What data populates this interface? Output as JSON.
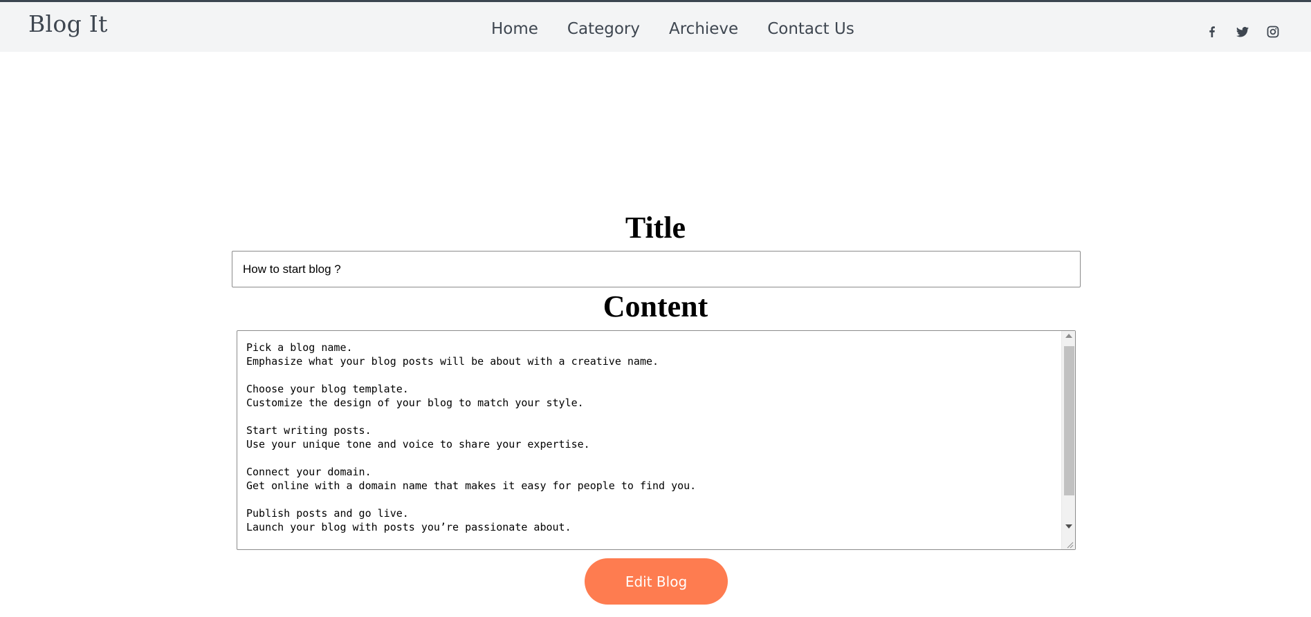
{
  "header": {
    "brand": "Blog It",
    "nav": [
      "Home",
      "Category",
      "Archieve",
      "Contact Us"
    ],
    "social_icons": [
      "facebook-icon",
      "twitter-icon",
      "instagram-icon"
    ]
  },
  "form": {
    "title_label": "Title",
    "title_value": "How to start blog ?",
    "content_label": "Content",
    "content_value": "Pick a blog name.\nEmphasize what your blog posts will be about with a creative name.\n\nChoose your blog template.\nCustomize the design of your blog to match your style.\n\nStart writing posts.\nUse your unique tone and voice to share your expertise.\n\nConnect your domain.\nGet online with a domain name that makes it easy for people to find you.\n\nPublish posts and go live.\nLaunch your blog with posts you’re passionate about.",
    "submit_label": "Edit Blog"
  },
  "colors": {
    "topbar_bg": "#f3f4f5",
    "text_dark": "#3e4650",
    "accent": "#fe7c50"
  }
}
